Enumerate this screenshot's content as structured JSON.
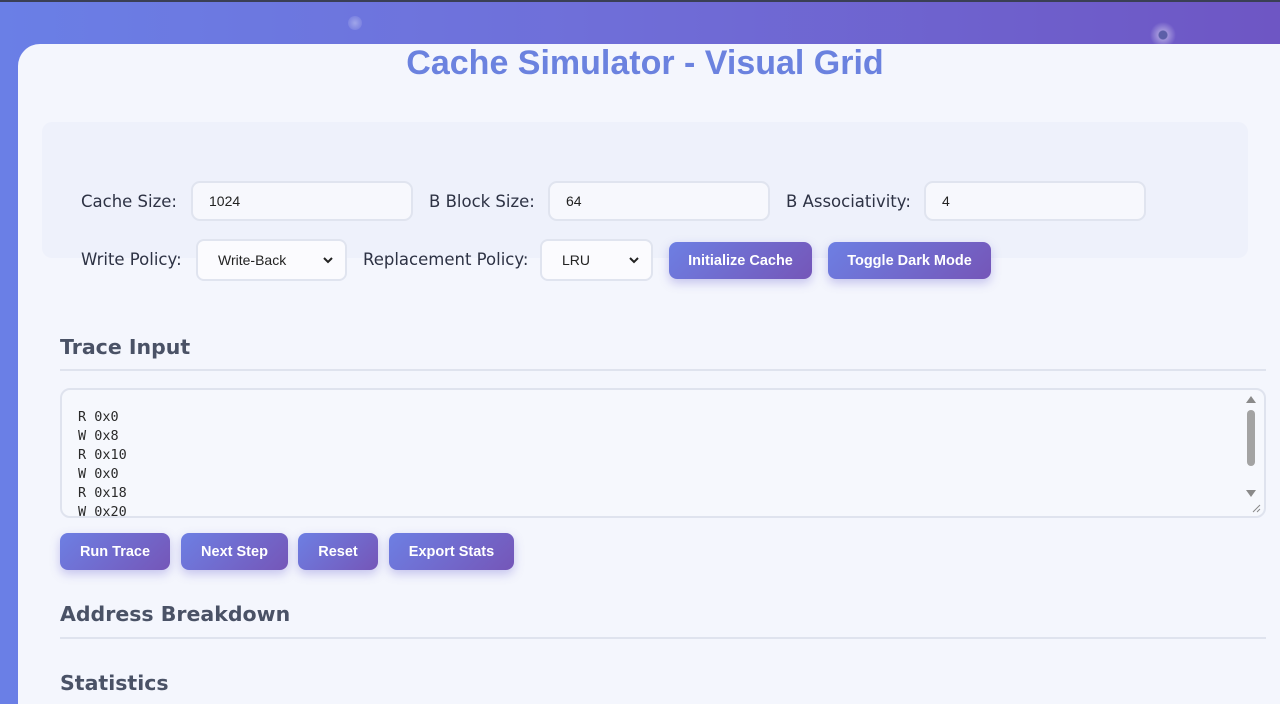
{
  "title": "Cache Simulator - Visual Grid",
  "config": {
    "cache_size_label": "Cache Size:",
    "cache_size_value": "1024",
    "block_size_label": "B Block Size:",
    "block_size_value": "64",
    "associativity_label": "B Associativity:",
    "associativity_value": "4",
    "write_policy_label": "Write Policy:",
    "write_policy_value": "Write-Back",
    "replacement_policy_label": "Replacement Policy:",
    "replacement_policy_value": "LRU",
    "init_button": "Initialize Cache",
    "dark_mode_button": "Toggle Dark Mode"
  },
  "trace": {
    "heading": "Trace Input",
    "text": "R 0x0\nW 0x8\nR 0x10\nW 0x0\nR 0x18\nW 0x20",
    "buttons": {
      "run": "Run Trace",
      "next": "Next Step",
      "reset": "Reset",
      "export": "Export Stats"
    }
  },
  "sections": {
    "address_breakdown": "Address Breakdown",
    "statistics": "Statistics"
  },
  "colors": {
    "accent": "#6b82df",
    "button_start": "#6d7fe3",
    "button_end": "#7556b8"
  }
}
